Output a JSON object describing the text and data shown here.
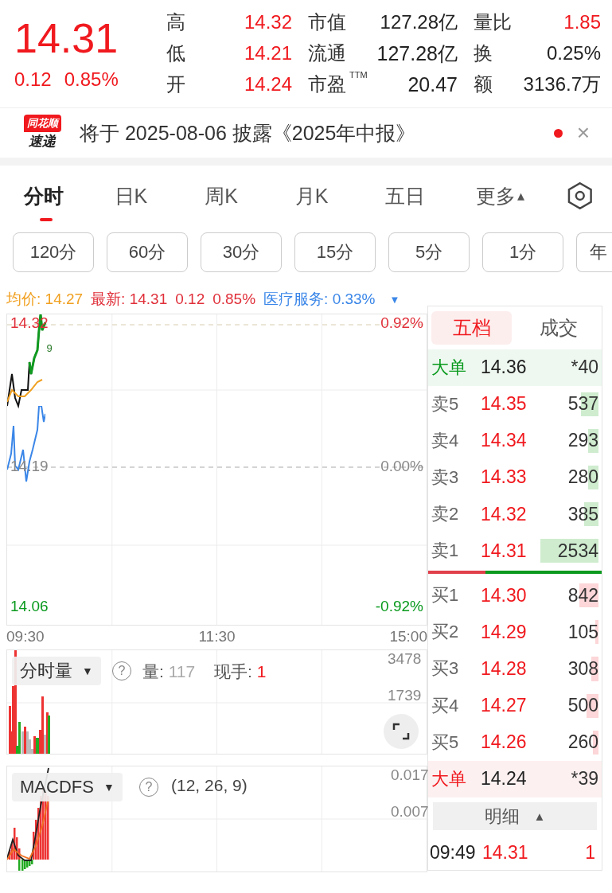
{
  "quote": {
    "price": "14.31",
    "change": "0.12",
    "change_pct": "0.85%",
    "stats": [
      [
        {
          "label": "高",
          "value": "14.32",
          "rising": true
        },
        {
          "label": "市值",
          "value": "127.28亿",
          "rising": false
        },
        {
          "label": "量比",
          "value": "1.85",
          "rising": true
        }
      ],
      [
        {
          "label": "低",
          "value": "14.21",
          "rising": true
        },
        {
          "label": "流通",
          "value": "127.28亿",
          "rising": false
        },
        {
          "label": "换",
          "value": "0.25%",
          "rising": false
        }
      ],
      [
        {
          "label": "开",
          "value": "14.24",
          "rising": true
        },
        {
          "label": "市盈$^{TTM}$",
          "value": "20.47",
          "rising": false
        },
        {
          "label": "额",
          "value": "3136.7万",
          "rising": false
        }
      ]
    ]
  },
  "notice": {
    "logo_top": "同花顺",
    "logo_bottom": "速递",
    "text": "将于 2025-08-06 披露《2025年中报》",
    "unread": true,
    "close": "×"
  },
  "chart_tabs": [
    {
      "label": "分时",
      "selected": true
    },
    {
      "label": "日K",
      "selected": false
    },
    {
      "label": "周K",
      "selected": false
    },
    {
      "label": "月K",
      "selected": false
    },
    {
      "label": "五日",
      "selected": false
    },
    {
      "label": "更多",
      "selected": false,
      "caret": "▴"
    }
  ],
  "periods": [
    "120分",
    "60分",
    "30分",
    "15分",
    "5分",
    "1分",
    "年"
  ],
  "legend": {
    "avg_label": "均价:",
    "avg": "14.27",
    "last_label": "最新:",
    "last": "14.31",
    "change": "0.12",
    "change_pct": "0.85%",
    "sector_label": "医疗服务:",
    "sector": "0.33%",
    "caret": "▼"
  },
  "price_chart": {
    "high": "14.32",
    "high_pct": "0.92%",
    "base": "14.19",
    "base_pct": "0.00%",
    "low": "14.06",
    "low_pct": "-0.92%",
    "badge": "9",
    "times": [
      "09:30",
      "11:30",
      "15:00"
    ]
  },
  "volume_panel": {
    "selector": "分时量",
    "caret": "▼",
    "help": "?",
    "vol_label": "量:",
    "vol": "117",
    "hand_label": "现手:",
    "hand": "1",
    "ticks": [
      "3478",
      "1739"
    ]
  },
  "macd_panel": {
    "selector": "MACDFS",
    "caret": "▼",
    "help": "?",
    "params": "(12, 26, 9)",
    "ticks": [
      "0.017",
      "0.007"
    ]
  },
  "order_book": {
    "tabs": [
      {
        "label": "五档",
        "selected": true
      },
      {
        "label": "成交",
        "selected": false
      }
    ],
    "rows": [
      {
        "kind": "big_sell",
        "label": "大单",
        "price": "14.36",
        "qty": "*40"
      },
      {
        "kind": "ask",
        "label": "卖5",
        "price": "14.35",
        "qty": "537",
        "level": 0.1
      },
      {
        "kind": "ask",
        "label": "卖4",
        "price": "14.34",
        "qty": "293",
        "level": 0.06
      },
      {
        "kind": "ask",
        "label": "卖3",
        "price": "14.33",
        "qty": "280",
        "level": 0.06
      },
      {
        "kind": "ask",
        "label": "卖2",
        "price": "14.32",
        "qty": "385",
        "level": 0.08
      },
      {
        "kind": "ask",
        "label": "卖1",
        "price": "14.31",
        "qty": "2534",
        "level": 0.33
      },
      {
        "kind": "divider",
        "level": 0.33
      },
      {
        "kind": "bid",
        "label": "买1",
        "price": "14.30",
        "qty": "842",
        "level": 0.11
      },
      {
        "kind": "bid",
        "label": "买2",
        "price": "14.29",
        "qty": "105",
        "level": 0.02
      },
      {
        "kind": "bid",
        "label": "买3",
        "price": "14.28",
        "qty": "308",
        "level": 0.04
      },
      {
        "kind": "bid",
        "label": "买4",
        "price": "14.27",
        "qty": "500",
        "level": 0.07
      },
      {
        "kind": "bid",
        "label": "买5",
        "price": "14.26",
        "qty": "260",
        "level": 0.03
      },
      {
        "kind": "big_buy",
        "label": "大单",
        "price": "14.24",
        "qty": "*39"
      }
    ],
    "detail": {
      "label": "明细",
      "caret": "▲"
    },
    "trades": [
      {
        "time": "09:49",
        "price": "14.31",
        "qty": "1"
      }
    ]
  }
}
